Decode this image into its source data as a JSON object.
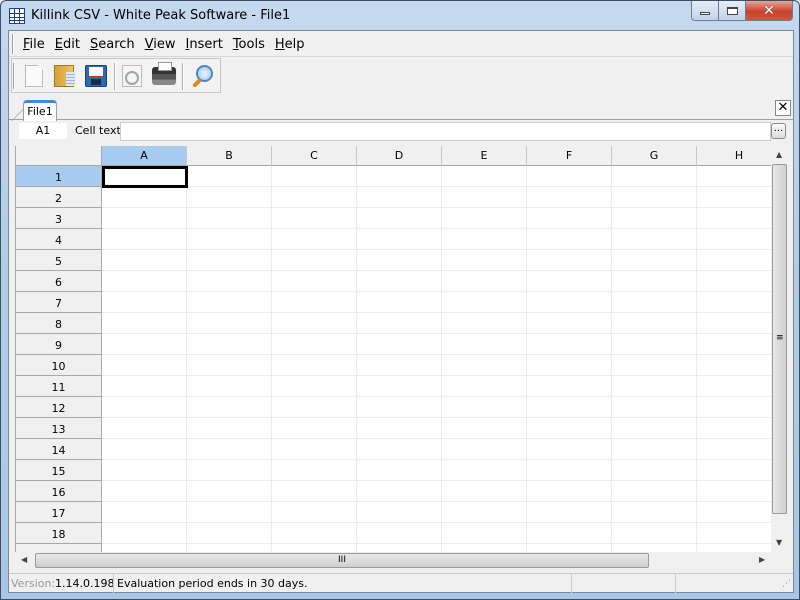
{
  "window": {
    "title": "Killink CSV - White Peak Software - File1"
  },
  "menu": [
    "File",
    "Edit",
    "Search",
    "View",
    "Insert",
    "Tools",
    "Help"
  ],
  "toolbar": [
    {
      "name": "new-file",
      "icon": "new-file-icon"
    },
    {
      "name": "open",
      "icon": "open-folder-icon"
    },
    {
      "name": "save",
      "icon": "save-disk-icon"
    },
    {
      "name": "print-preview",
      "icon": "print-preview-icon"
    },
    {
      "name": "print",
      "icon": "printer-icon"
    },
    {
      "name": "find",
      "icon": "magnifier-icon"
    }
  ],
  "tabs": [
    {
      "label": "File1",
      "active": true
    }
  ],
  "formula": {
    "cell_ref": "A1",
    "label": "Cell text:",
    "value": "",
    "more_label": "..."
  },
  "grid": {
    "columns": [
      "A",
      "B",
      "C",
      "D",
      "E",
      "F",
      "G",
      "H"
    ],
    "rows": [
      "1",
      "2",
      "3",
      "4",
      "5",
      "6",
      "7",
      "8",
      "9",
      "10",
      "11",
      "12",
      "13",
      "14",
      "15",
      "16",
      "17",
      "18"
    ],
    "selected_cell": "A1"
  },
  "scroll": {
    "h_grip": "III",
    "v_grip": "≡"
  },
  "status": {
    "version_label": "Version:",
    "version": "1.14.0.198",
    "message": "Evaluation period ends in 30 days."
  },
  "colors": {
    "selection": "#a8cbf0",
    "tab_accent": "#3c8ce0",
    "close_button": "#c7432e"
  }
}
